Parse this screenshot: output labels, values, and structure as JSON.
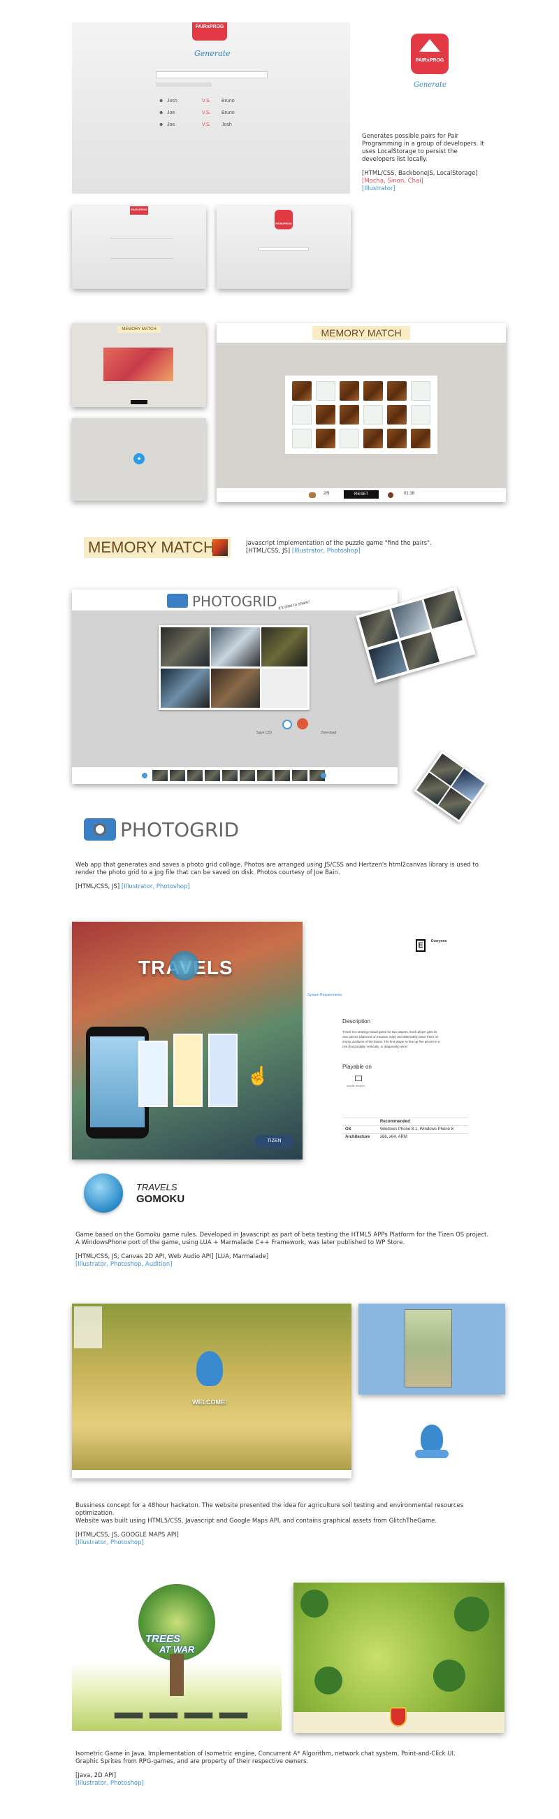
{
  "pairprog": {
    "logo_text": "PAIRxPROG",
    "subtitle": "Generate",
    "pairs": [
      {
        "left": "Josh",
        "vs": "V.S.",
        "right": "Bruno"
      },
      {
        "left": "Joe",
        "vs": "V.S.",
        "right": "Bruno"
      },
      {
        "left": "Joe",
        "vs": "V.S.",
        "right": "Josh"
      }
    ],
    "desc": "Generates possible pairs for Pair Programming in a group of developers. It uses LocalStorage to persist the developers list locally.",
    "tech": "[HTML/CSS, BackboneJS, LocalStorage]",
    "tech_extra": "[Mocha, Sinon, Chai]",
    "tech_design": "[Illustrator]"
  },
  "memory": {
    "logo_text": "MEMORY MATCH",
    "reset_label": "RESET",
    "score": "2/9",
    "time": "01:18",
    "desc": "Javascript implementation of the puzzle game \"find the pairs\".",
    "tech": "[HTML/CSS, JS]",
    "tech_design": "[Illustrator, Photoshop]"
  },
  "photogrid": {
    "logo_text": "PHOTOGRID",
    "share_note": "It's time to share!",
    "btn_left": "Save (JS)",
    "btn_right": "Download",
    "desc": "Web app that generates and saves a photo grid collage. Photos are arranged using JS/CSS and  Hertzen's html2canvas library is used to render the photo grid to a jpg file that can be saved on disk. Photos courtesy of Joe Bain.",
    "tech": "[HTML/CSS, JS]",
    "tech_design": "[Illustrator, Photoshop]"
  },
  "travels": {
    "banner": "TRAVELS",
    "rating": "Everyone",
    "sysreq": "System Requirements",
    "description_head": "Description",
    "description_body": "Travel 5 is strategy board game for two players. Each player gets its own pieces (diamond or treasure map) and alternately place them on empty positions of the board. The first player to line up five pieces in a row (horizontally, vertically, or diagonally) wins!",
    "playable_on": "Playable on",
    "device": "mobile devices",
    "recommended": "Recommended",
    "os_label": "OS",
    "os_value": "Windows Phone 8.1, Windows Phone 8",
    "arch_label": "Architecture",
    "arch_value": "x86, x64, ARM",
    "title_small": "TRAVELS",
    "title_big": "GOMOKU",
    "desc1": "Game based on the Gomoku game rules. Developed in Javascript as part of beta testing the HTML5 APPs Platform for the Tizen OS project.",
    "desc2": "A WindowsPhone port of the game, using LUA + Marmalade C++ Framework, was later published to WP Store.",
    "tech": "[HTML/CSS, JS, Canvas 2D API, Web Audio API] [LUA, Marmalade]",
    "tech_design": "[Illustrator, Photoshop, Audition]",
    "tizen": "TIZEN"
  },
  "agro": {
    "welcome": "WELCOME!",
    "desc1": "Bussiness concept for a 48hour hackaton. The website presented the idea for agriculture soil testing and environmental resources optimization.",
    "desc2": "Website was built using HTML5/CSS, Javascript and Google Maps API, and contains graphical assets from GlitchTheGame.",
    "tech": "[HTML/CSS, JS, GOOGLE MAPS API]",
    "tech_design": "[Illustrator, Photoshop]"
  },
  "treewar": {
    "title_line1": "TREES",
    "title_line2": "AT WAR",
    "desc1": "Isometric Game in Java, Implementation of Isometric engine, Concurrent A* Algorithm, network chat system, Point-and-Click UI.",
    "desc2": "Graphic Sprites from RPG-games, and are property of their respective owners.",
    "tech": "[Java, 2D API]",
    "tech_design": "[Illustrator, Photoshop]"
  }
}
